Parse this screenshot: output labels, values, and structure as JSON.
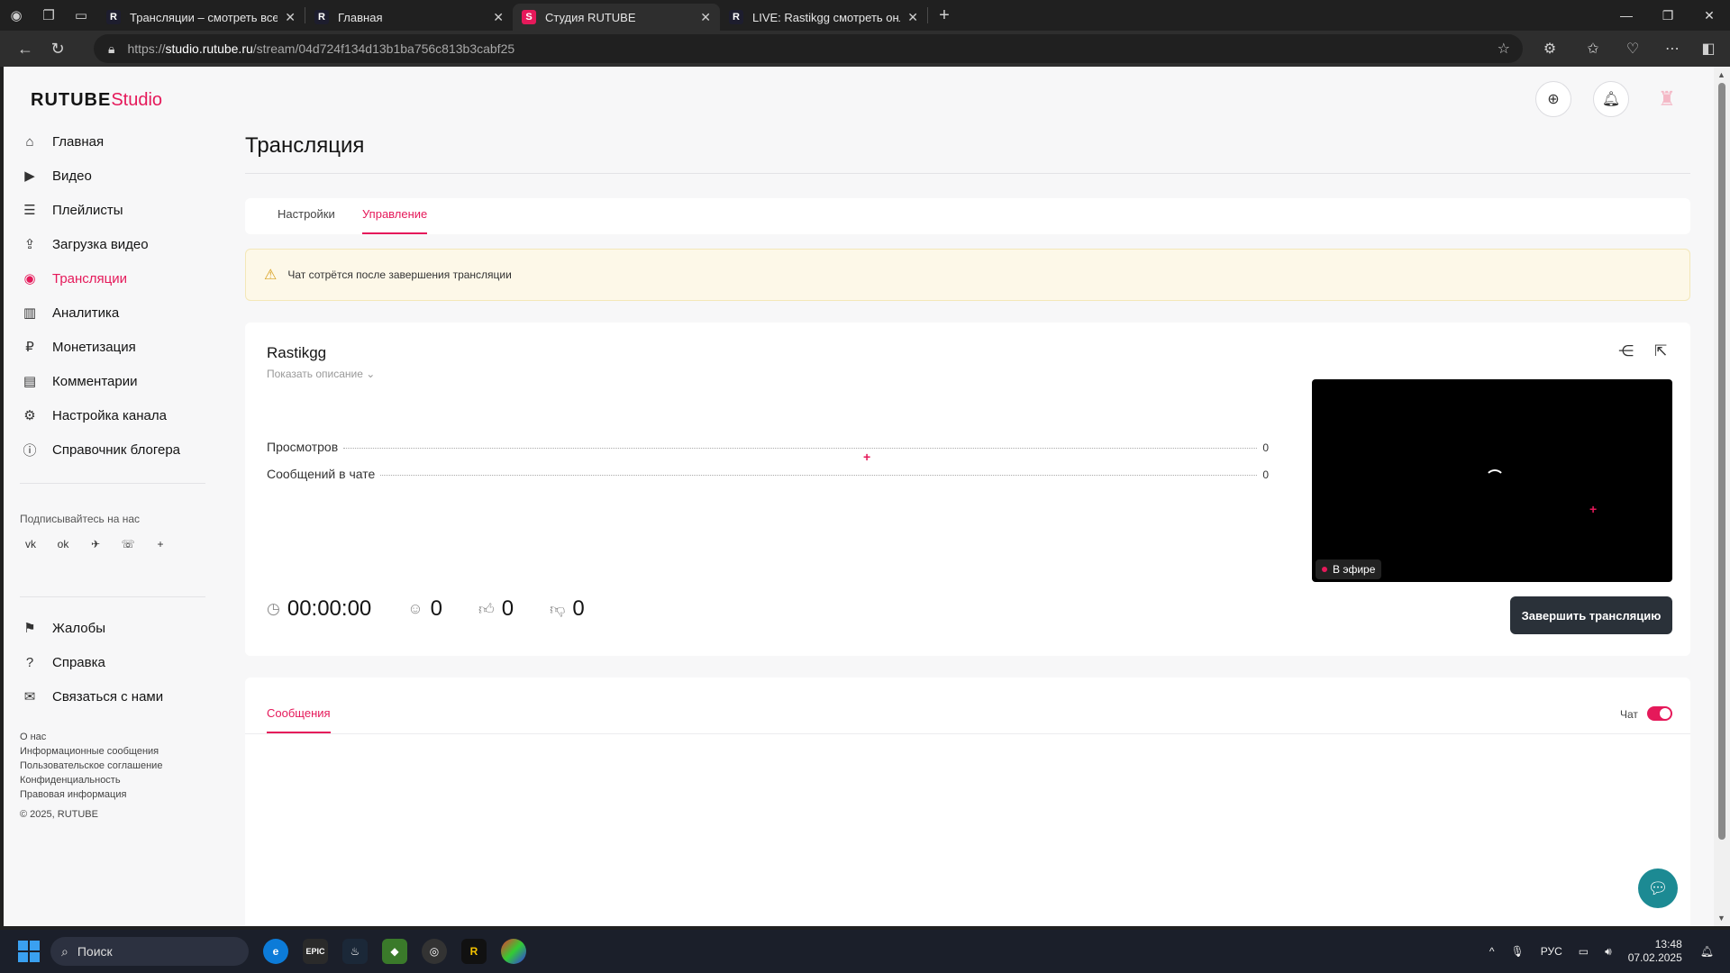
{
  "browser": {
    "tabs": [
      {
        "favicon": "R",
        "title": "Трансляции – смотреть все видео",
        "active": false
      },
      {
        "favicon": "R",
        "title": "Главная",
        "active": false
      },
      {
        "favicon": "S",
        "title": "Студия RUTUBE",
        "active": true
      },
      {
        "favicon": "R",
        "title": "LIVE: Rastikgg смотреть онлайн",
        "active": false
      }
    ],
    "url_prefix": "https://",
    "url_host": "studio.rutube.ru",
    "url_path": "/stream/04d724f134d13b1ba756c813b3cabf25"
  },
  "sidebar": {
    "logo_main": "RUTUBE",
    "logo_sub": "Studio",
    "items": [
      {
        "label": "Главная",
        "icon": "home-icon"
      },
      {
        "label": "Видео",
        "icon": "video-icon"
      },
      {
        "label": "Плейлисты",
        "icon": "playlist-icon"
      },
      {
        "label": "Загрузка видео",
        "icon": "upload-icon"
      },
      {
        "label": "Трансляции",
        "icon": "broadcast-icon",
        "active": true
      },
      {
        "label": "Аналитика",
        "icon": "analytics-icon"
      },
      {
        "label": "Монетизация",
        "icon": "monetization-icon"
      },
      {
        "label": "Комментарии",
        "icon": "comments-icon"
      },
      {
        "label": "Настройка канала",
        "icon": "settings-icon"
      },
      {
        "label": "Справочник блогера",
        "icon": "guide-icon"
      }
    ],
    "follow_label": "Подписывайтесь на нас",
    "social": [
      "vk-icon",
      "ok-icon",
      "telegram-icon",
      "viber-icon",
      "plus-icon"
    ],
    "items2": [
      {
        "label": "Жалобы",
        "icon": "flag-icon"
      },
      {
        "label": "Справка",
        "icon": "help-icon"
      },
      {
        "label": "Связаться с нами",
        "icon": "mail-icon"
      }
    ],
    "footer_links": [
      "О нас",
      "Информационные сообщения",
      "Пользовательское соглашение",
      "Конфиденциальность",
      "Правовая информация"
    ],
    "copyright": "© 2025, RUTUBE"
  },
  "main": {
    "title": "Трансляция",
    "tabs": [
      {
        "label": "Настройки",
        "active": false
      },
      {
        "label": "Управление",
        "active": true
      }
    ],
    "warning": "Чат сотрётся после завершения трансляции",
    "stream": {
      "name": "Rastikgg",
      "show_description": "Показать описание",
      "stats": [
        {
          "label": "Просмотров",
          "value": "0"
        },
        {
          "label": "Сообщений в чате",
          "value": "0"
        }
      ],
      "live_label": "В эфире",
      "duration": "00:00:00",
      "viewers": "0",
      "likes": "0",
      "dislikes": "0",
      "end_button": "Завершить трансляцию"
    },
    "chat": {
      "tab_label": "Сообщения",
      "toggle_label": "Чат",
      "toggle_on": true
    }
  },
  "taskbar": {
    "search_placeholder": "Поиск",
    "language": "РУС",
    "time": "13:48",
    "date": "07.02.2025"
  },
  "colors": {
    "accent": "#e5195a",
    "dark_button": "#2a3139",
    "warning_bg": "#fdf8e8"
  }
}
